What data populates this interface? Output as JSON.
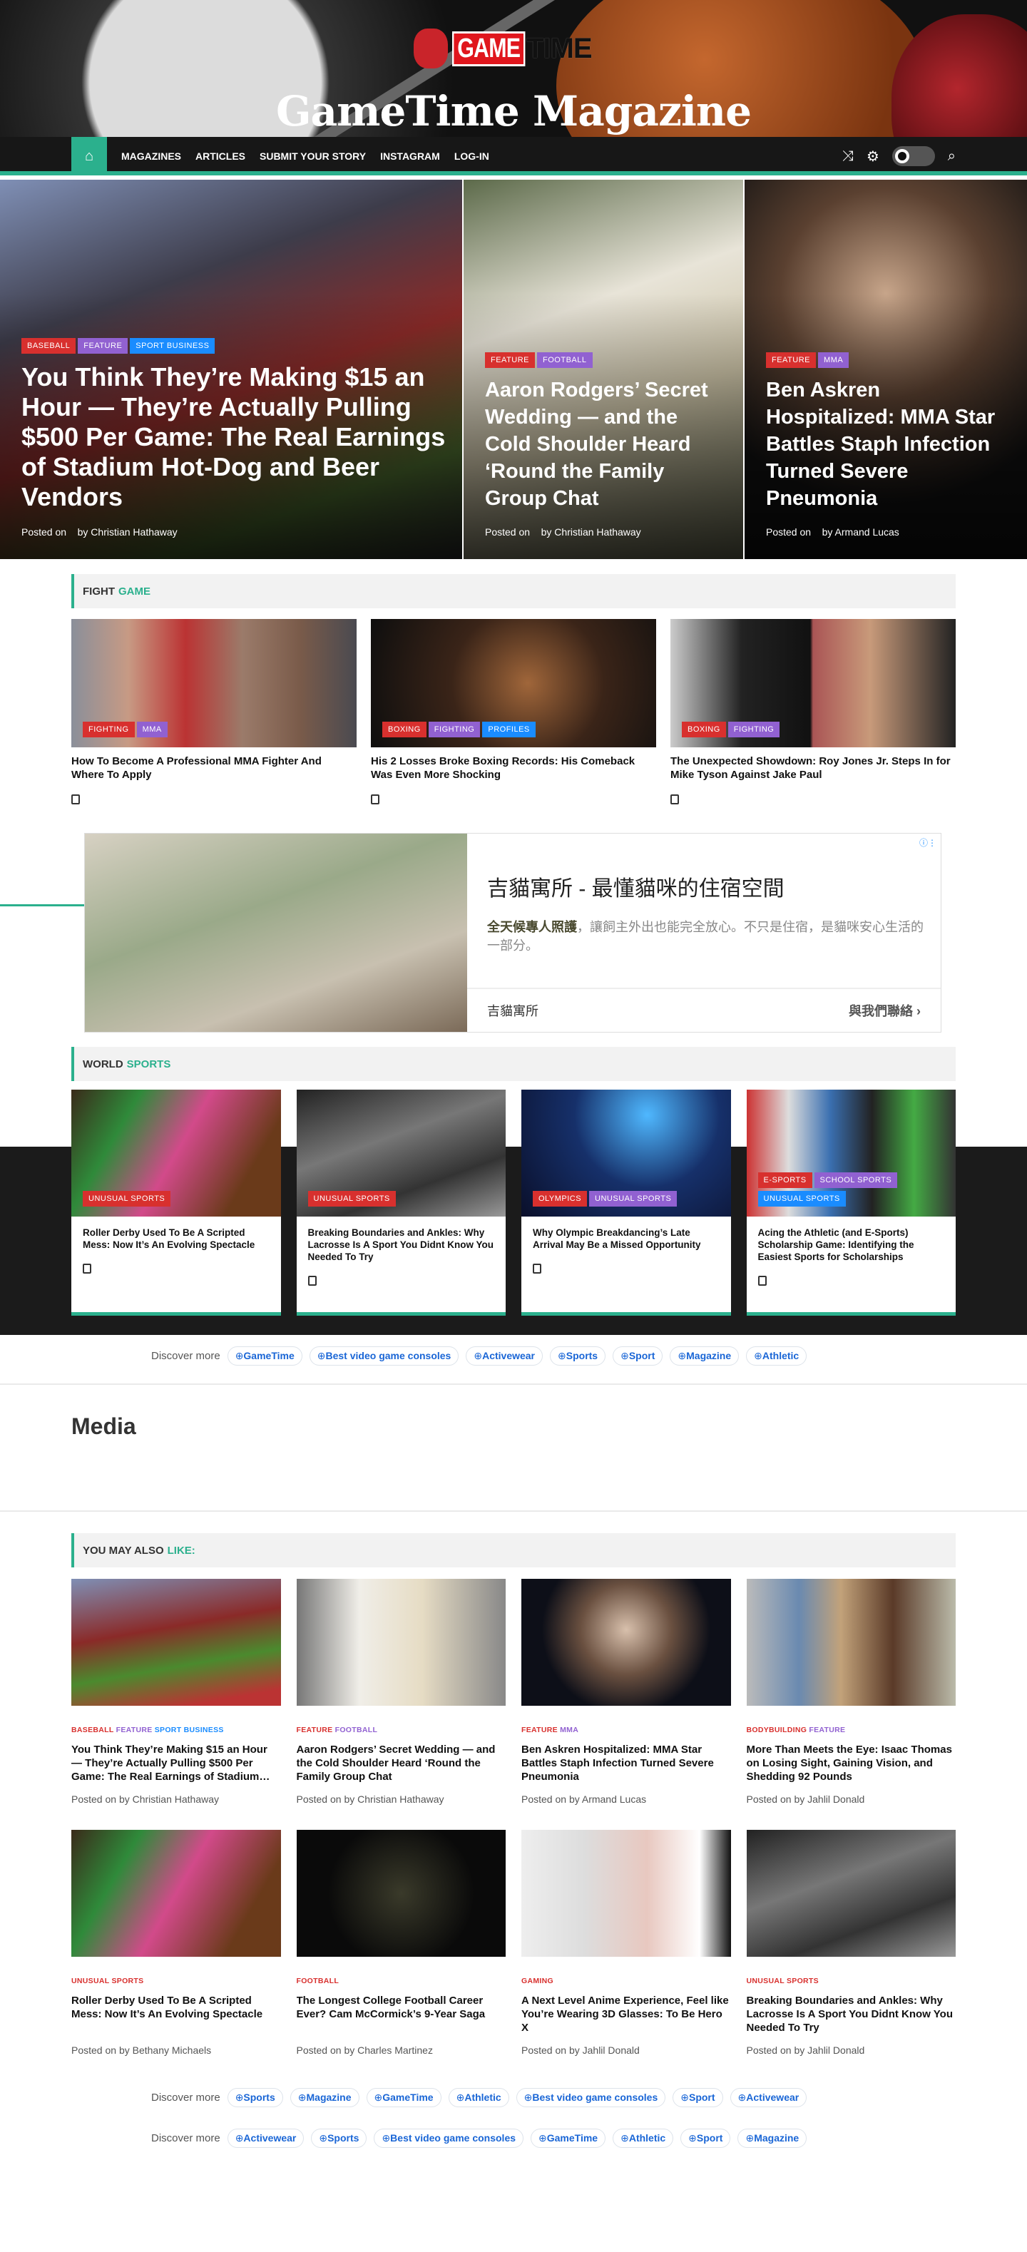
{
  "header": {
    "logo_game": "GAME",
    "logo_time": "TIME",
    "title": "GameTime Magazine"
  },
  "nav": {
    "items": [
      "MAGAZINES",
      "ARTICLES",
      "SUBMIT YOUR STORY",
      "INSTAGRAM",
      "LOG-IN"
    ]
  },
  "hero": [
    {
      "tags": [
        [
          "Baseball",
          "red"
        ],
        [
          "Feature",
          "pur"
        ],
        [
          "Sport Business",
          "blu"
        ]
      ],
      "title": "You Think They’re Making $15 an Hour — They’re Actually Pulling $500 Per Game: The Real Earnings of Stadium Hot-Dog and Beer Vendors",
      "posted": "Posted on",
      "by": "by Christian Hathaway",
      "img": "linear-gradient(160deg,#7f8fb5,#3d3c4a 30%,#8a2a28 55%,#4b6a2e 80%,#2d2d2d)"
    },
    {
      "tags": [
        [
          "Feature",
          "red"
        ],
        [
          "Football",
          "pur"
        ]
      ],
      "title": "Aaron Rodgers’ Secret Wedding — and the Cold Shoulder Heard ‘Round the Family Group Chat",
      "posted": "Posted on",
      "by": "by Christian Hathaway",
      "img": "linear-gradient(160deg,#5c6a4a,#e8e4d8 35%,#cdc4a8 60%,#6e7157)"
    },
    {
      "tags": [
        [
          "Feature",
          "red"
        ],
        [
          "MMA",
          "pur"
        ]
      ],
      "title": "Ben Askren Hospitalized: MMA Star Battles Staph Infection Turned Severe Pneumonia",
      "posted": "Posted on",
      "by": "by Armand Lucas",
      "img": "radial-gradient(circle at 50% 30%,#c7a58a,#5a4030 35%,#111 70%)"
    }
  ],
  "fight_game": {
    "title": "Fight",
    "highlight": "Game",
    "cards": [
      {
        "tags": [
          [
            "Fighting",
            "red"
          ],
          [
            "MMA",
            "pur"
          ]
        ],
        "title": "How To Become A Professional MMA Fighter And Where To Apply",
        "img": "linear-gradient(90deg,#8a8f9a,#c79a84,#b33,#9b7b6a,#7a5b4a,#4a4a50)"
      },
      {
        "tags": [
          [
            "Boxing",
            "red"
          ],
          [
            "Fighting",
            "pur"
          ],
          [
            "Profiles",
            "blu"
          ]
        ],
        "title": "His 2 Losses Broke Boxing Records: His Comeback Was Even More Shocking",
        "img": "radial-gradient(circle at 55% 50%,#a0663a,#3a2418 45%,#0e0e0e)"
      },
      {
        "tags": [
          [
            "Boxing",
            "red"
          ],
          [
            "Fighting",
            "pur"
          ]
        ],
        "title": "The Unexpected Showdown: Roy Jones Jr. Steps In for Mike Tyson Against Jake Paul",
        "img": "linear-gradient(90deg,#ccc,#222 25%,#111 49%,#a55 50%,#c89a7a 70%,#222)"
      }
    ]
  },
  "ad": {
    "title": "吉貓寓所 - 最懂貓咪的住宿空間",
    "desc_bold": "全天候專人照護",
    "desc": "，讓飼主外出也能完全放心。不只是住宿，是貓咪安心生活的一部分。",
    "brand": "吉貓寓所",
    "cta": "與我們聯絡"
  },
  "world_sports": {
    "title": "World",
    "highlight": "Sports",
    "cards": [
      {
        "tags": [
          [
            "Unusual Sports",
            "red"
          ]
        ],
        "title": "Roller Derby Used To Be A Scripted Mess: Now It’s An Evolving Spectacle",
        "img": "linear-gradient(120deg,#3a2a1a,#2f8a3a 25%,#d24a8a 50%,#6a3a1a 80%)"
      },
      {
        "tags": [
          [
            "Unusual Sports",
            "red"
          ]
        ],
        "title": "Breaking Boundaries and Ankles: Why Lacrosse Is A Sport You Didnt Know You Needed To Try",
        "img": "linear-gradient(160deg,#222,#777 40%,#333 70%,#999)"
      },
      {
        "tags": [
          [
            "Olympics",
            "red"
          ],
          [
            "Unusual Sports",
            "pur"
          ]
        ],
        "title": "Why Olympic Breakdancing’s Late Arrival May Be a Missed Opportunity",
        "img": "radial-gradient(circle at 60% 20%,#4fb8ff,#16306a 45%,#0a0f2a)"
      },
      {
        "tags": [
          [
            "E-Sports",
            "red"
          ],
          [
            "School Sports",
            "pur"
          ],
          [
            "Unusual Sports",
            "blu"
          ]
        ],
        "title": "Acing the Athletic (and E-Sports) Scholarship Game: Identifying the Easiest Sports for Scholarships",
        "img": "linear-gradient(90deg,#c33,#ddd 20%,#3a6fb0 40%,#222 60%,#4a4 80%,#333)"
      }
    ]
  },
  "discover_1": {
    "label": "Discover more",
    "chips": [
      "GameTime",
      "Best video game consoles",
      "Activewear",
      "Sports",
      "Sport",
      "Magazine",
      "Athletic"
    ]
  },
  "media": {
    "title": "Media"
  },
  "you_may_like": {
    "title": "You may also",
    "highlight": "like:",
    "cards": [
      {
        "cats": [
          [
            "Baseball",
            "red"
          ],
          [
            "Feature",
            "pur"
          ],
          [
            "Sport Business",
            "blu"
          ]
        ],
        "title": "You Think They’re Making $15 an Hour — They’re Actually Pulling $500 Per Game: The Real Earnings of Stadium…",
        "posted": "Posted on by",
        "author": "Christian Hathaway",
        "img": "linear-gradient(170deg,#7f8fb5,#8a2a28 40%,#4b8a2e 65%,#b33 90%)"
      },
      {
        "cats": [
          [
            "Feature",
            "red"
          ],
          [
            "Football",
            "pur"
          ]
        ],
        "title": "Aaron Rodgers’ Secret Wedding — and the Cold Shoulder Heard ‘Round the Family Group Chat",
        "posted": "Posted on by",
        "author": "Christian Hathaway",
        "img": "linear-gradient(90deg,#777,#f0eee8 30%,#e6dcc4 60%,#888)"
      },
      {
        "cats": [
          [
            "Feature",
            "red"
          ],
          [
            "MMA",
            "pur"
          ]
        ],
        "title": "Ben Askren Hospitalized: MMA Star Battles Staph Infection Turned Severe Pneumonia",
        "posted": "Posted on by",
        "author": "Armand Lucas",
        "img": "radial-gradient(circle at 50% 40%,#d8c0ac,#6a5040 35%,#0d0f18 65%)"
      },
      {
        "cats": [
          [
            "Bodybuilding",
            "red"
          ],
          [
            "Feature",
            "pur"
          ]
        ],
        "title": "More Than Meets the Eye: Isaac Thomas on Losing Sight, Gaining Vision, and Shedding 92 Pounds",
        "posted": "Posted on by",
        "author": "Jahlil Donald",
        "img": "linear-gradient(90deg,#bbb,#6a8ab0 25%,#c2a27a 45%,#5a3a28 70%,#bba)"
      },
      {
        "cats": [
          [
            "Unusual Sports",
            "red"
          ]
        ],
        "title": "Roller Derby Used To Be A Scripted Mess: Now It’s An Evolving Spectacle",
        "posted": "Posted on by",
        "author": "Bethany Michaels",
        "img": "linear-gradient(120deg,#3a2a1a,#2f8a3a 25%,#d24a8a 50%,#6a3a1a 80%)"
      },
      {
        "cats": [
          [
            "Football",
            "red"
          ]
        ],
        "title": "The Longest College Football Career Ever? Cam McCormick’s 9-Year Saga",
        "posted": "Posted on by",
        "author": "Charles Martinez",
        "img": "radial-gradient(circle at 50% 50%,#3a3a2a,#0a0a0a 60%)"
      },
      {
        "cats": [
          [
            "Gaming",
            "red"
          ]
        ],
        "title": "A Next Level Anime Experience, Feel like You’re Wearing 3D Glasses: To Be Hero X",
        "posted": "Posted on by",
        "author": "Jahlil Donald",
        "img": "linear-gradient(90deg,#eee,#ddd 30%,#e8c8c0 60%,#fff 85%,#111)"
      },
      {
        "cats": [
          [
            "Unusual Sports",
            "red"
          ]
        ],
        "title": "Breaking Boundaries and Ankles: Why Lacrosse Is A Sport You Didnt Know You Needed To Try",
        "posted": "Posted on by",
        "author": "Jahlil Donald",
        "img": "linear-gradient(160deg,#222,#777 40%,#333 70%,#999)"
      }
    ]
  },
  "discover_2": {
    "label": "Discover more",
    "chips": [
      "Sports",
      "Magazine",
      "GameTime",
      "Athletic",
      "Best video game consoles",
      "Sport",
      "Activewear"
    ]
  },
  "discover_3": {
    "label": "Discover more",
    "chips": [
      "Activewear",
      "Sports",
      "Best video game consoles",
      "GameTime",
      "Athletic",
      "Sport",
      "Magazine"
    ]
  }
}
